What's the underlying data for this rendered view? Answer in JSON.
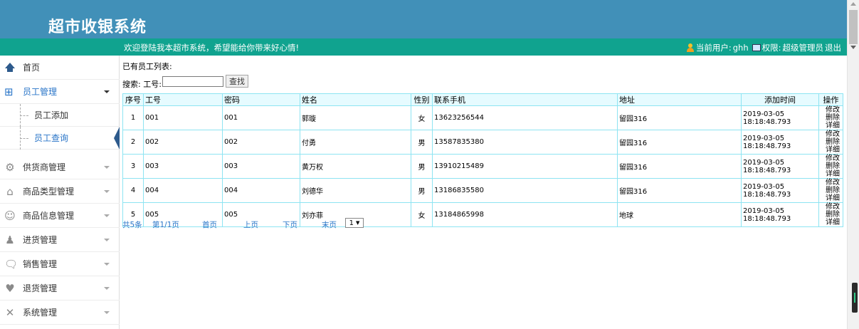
{
  "header": {
    "title": "超市收银系统"
  },
  "topbar": {
    "welcome": "欢迎登陆我本超市系统，希望能给你带来好心情!",
    "current_user_label": "当前用户:",
    "current_user": "ghh",
    "permission_label": "权限:",
    "permission": "超级管理员",
    "logout": "退出"
  },
  "sidebar": {
    "items": [
      {
        "label": "首页"
      },
      {
        "label": "员工管理"
      },
      {
        "label": "供货商管理"
      },
      {
        "label": "商品类型管理"
      },
      {
        "label": "商品信息管理"
      },
      {
        "label": "进货管理"
      },
      {
        "label": "销售管理"
      },
      {
        "label": "退货管理"
      },
      {
        "label": "系统管理"
      }
    ],
    "sub_items": [
      {
        "label": "员工添加"
      },
      {
        "label": "员工查询"
      }
    ]
  },
  "main": {
    "list_title": "已有员工列表:",
    "search_label": "搜索: 工号:",
    "search_value": "",
    "search_button": "查找",
    "columns": [
      "序号",
      "工号",
      "密码",
      "姓名",
      "性别",
      "联系手机",
      "地址",
      "添加时间",
      "操作"
    ],
    "rows": [
      [
        "1",
        "001",
        "001",
        "郭璇",
        "女",
        "13623256544",
        "留园316",
        "2019-03-05 18:18:48.793"
      ],
      [
        "2",
        "002",
        "002",
        "付勇",
        "男",
        "13587835380",
        "留园316",
        "2019-03-05 18:18:48.793"
      ],
      [
        "3",
        "003",
        "003",
        "黄万权",
        "男",
        "13910215489",
        "留园316",
        "2019-03-05 18:18:48.793"
      ],
      [
        "4",
        "004",
        "004",
        "刘德华",
        "男",
        "13186835580",
        "留园316",
        "2019-03-05 18:18:48.793"
      ],
      [
        "5",
        "005",
        "005",
        "刘亦菲",
        "女",
        "13184865998",
        "地球",
        "2019-03-05 18:18:48.793"
      ]
    ],
    "ops": {
      "edit": "修改",
      "delete": "删除",
      "detail": "详细"
    }
  },
  "pager": {
    "total": "共5条",
    "page_info": "第1/1页",
    "first": "首页",
    "prev": "上页",
    "next": "下页",
    "last": "末页",
    "page_select": "1"
  }
}
